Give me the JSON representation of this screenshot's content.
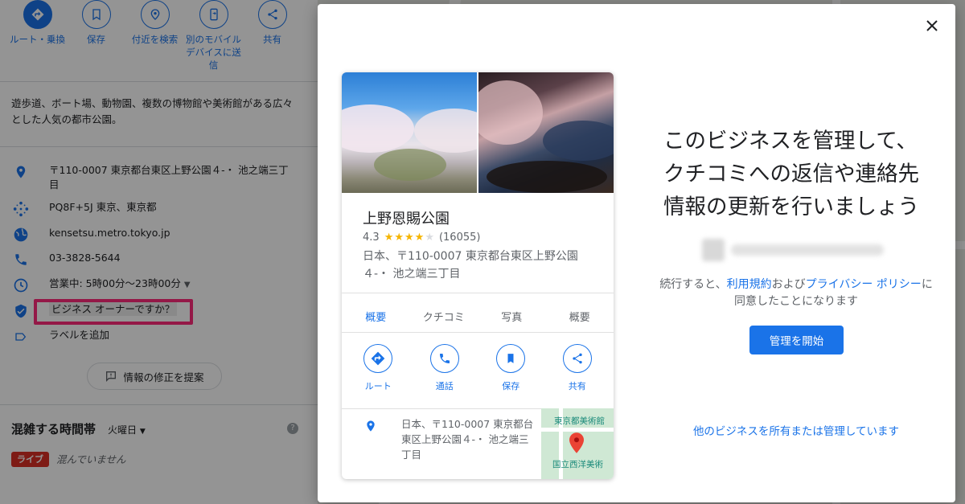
{
  "panel": {
    "actions": [
      {
        "label": "ルート・乗換",
        "icon": "directions-icon"
      },
      {
        "label": "保存",
        "icon": "bookmark-icon"
      },
      {
        "label": "付近を検索",
        "icon": "nearby-icon"
      },
      {
        "label": "別のモバイルデバイスに送信",
        "icon": "send-to-phone-icon"
      },
      {
        "label": "共有",
        "icon": "share-icon"
      }
    ],
    "description": "遊歩道、ボート場、動物園、複数の博物館や美術館がある広々とした人気の都市公園。",
    "info": {
      "address": "〒110-0007 東京都台東区上野公園４-・ 池之端三丁目",
      "plus_code": "PQ8F+5J 東京、東京都",
      "website": "kensetsu.metro.tokyo.jp",
      "phone": "03-3828-5644",
      "hours": "営業中: 5時00分～23時00分",
      "owner": "ビジネス オーナーですか？",
      "add_label": "ラベルを追加"
    },
    "suggest_edit": "情報の修正を提案",
    "popular_times": {
      "title": "混雑する時間帯",
      "day": "火曜日",
      "live_badge": "ライブ",
      "live_text": "混んでいません"
    }
  },
  "modal": {
    "card": {
      "name": "上野恩賜公園",
      "rating": "4.3",
      "stars_filled": 4,
      "reviews": "(16055)",
      "address": "日本、〒110-0007 東京都台東区上野公園４-・ 池之端三丁目",
      "tabs": [
        "概要",
        "クチコミ",
        "写真",
        "概要"
      ],
      "actions": [
        {
          "label": "ルート",
          "icon": "directions-icon"
        },
        {
          "label": "通話",
          "icon": "phone-icon"
        },
        {
          "label": "保存",
          "icon": "bookmark-icon"
        },
        {
          "label": "共有",
          "icon": "share-icon"
        }
      ],
      "address_short": "日本、〒110-0007 東京都台東区上野公園４-・ 池之端三丁目",
      "map_labels": [
        "東京都美術館",
        "国立西洋美術"
      ]
    },
    "headline": "このビジネスを管理して、クチコミへの返信や連絡先情報の更新を行いましょう",
    "consent_prefix": "続行すると、",
    "terms_link": "利用規約",
    "consent_and": "および",
    "privacy_link": "プライバシー ポリシー",
    "consent_suffix": "に同意したことになります",
    "primary_button": "管理を開始",
    "other_business": "他のビジネスを所有または管理しています"
  },
  "colors": {
    "accent": "#1a73e8",
    "highlight": "#ff2a7a",
    "live": "#d93025",
    "star": "#f5b400"
  }
}
